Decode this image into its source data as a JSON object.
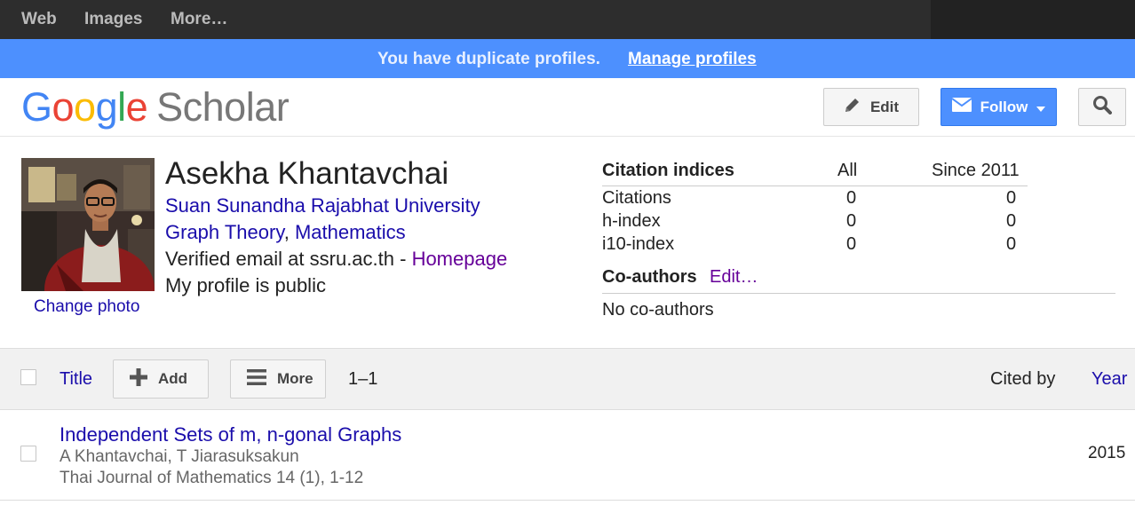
{
  "topnav": {
    "web": "Web",
    "images": "Images",
    "more": "More…"
  },
  "notice": {
    "text": "You have duplicate profiles.",
    "link": "Manage profiles"
  },
  "header": {
    "logo_google": [
      "G",
      "o",
      "o",
      "g",
      "l",
      "e"
    ],
    "logo_scholar": "Scholar",
    "edit_label": "Edit",
    "follow_label": "Follow"
  },
  "profile": {
    "change_photo": "Change photo",
    "name": "Asekha Khantavchai",
    "affiliation": "Suan Sunandha Rajabhat University",
    "interests": [
      "Graph Theory",
      "Mathematics"
    ],
    "interests_sep": ", ",
    "verified": "Verified email at ssru.ac.th - ",
    "homepage": "Homepage",
    "public": "My profile is public"
  },
  "citations": {
    "header": {
      "label": "Citation indices",
      "all": "All",
      "since": "Since 2011"
    },
    "rows": [
      {
        "label": "Citations",
        "all": "0",
        "since": "0"
      },
      {
        "label": "h-index",
        "all": "0",
        "since": "0"
      },
      {
        "label": "i10-index",
        "all": "0",
        "since": "0"
      }
    ]
  },
  "coauthors": {
    "title": "Co-authors",
    "edit": "Edit…",
    "none": "No co-authors"
  },
  "toolbar": {
    "title": "Title",
    "add": "Add",
    "more": "More",
    "range": "1–1",
    "cited_by": "Cited by",
    "year": "Year"
  },
  "articles": [
    {
      "title": "Independent Sets of m, n-gonal Graphs",
      "authors": "A Khantavchai, T Jiarasuksakun",
      "venue": "Thai Journal of Mathematics 14 (1), 1-12",
      "year": "2015"
    }
  ],
  "colors": {
    "notice_blue": "#4d90fe",
    "link_blue": "#1a0dab",
    "link_purple": "#660099"
  }
}
